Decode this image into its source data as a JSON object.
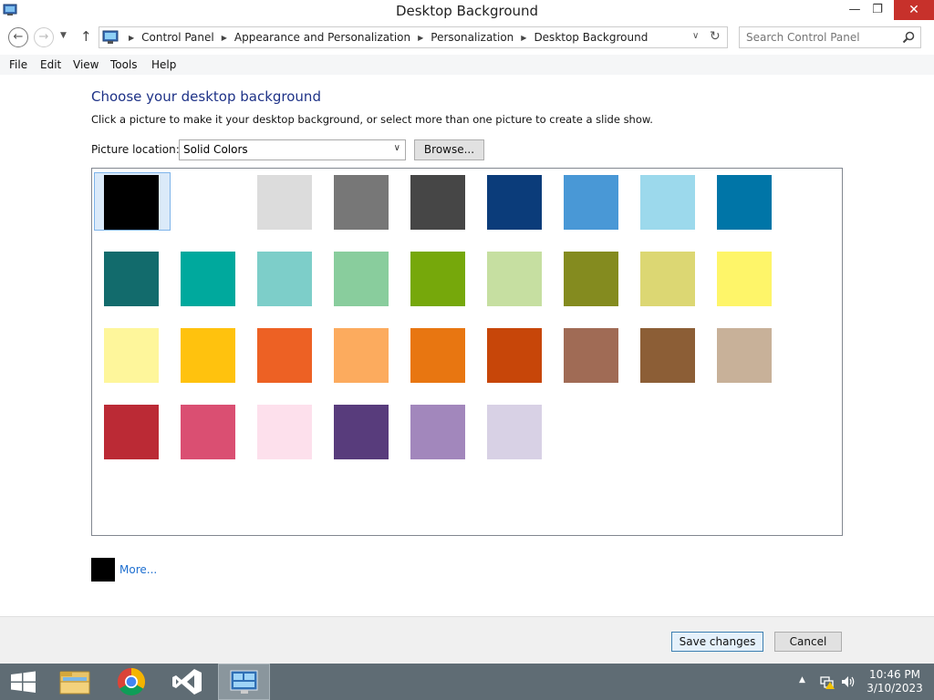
{
  "window": {
    "title": "Desktop Background",
    "minimize_glyph": "—",
    "maximize_glyph": "❐",
    "close_glyph": "✕"
  },
  "nav": {
    "breadcrumbs": [
      "Control Panel",
      "Appearance and Personalization",
      "Personalization",
      "Desktop Background"
    ],
    "search_placeholder": "Search Control Panel"
  },
  "menu": [
    "File",
    "Edit",
    "View",
    "Tools",
    "Help"
  ],
  "main": {
    "heading": "Choose your desktop background",
    "instruction": "Click a picture to make it your desktop background, or select more than one picture to create a slide show.",
    "location_label": "Picture location:",
    "location_value": "Solid Colors",
    "browse_label": "Browse...",
    "more_label": "More...",
    "current_color": "#000000",
    "selected_index": 0,
    "colors": [
      "#000000",
      "#ffffff",
      "#dcdcdc",
      "#777777",
      "#464646",
      "#0b3c7a",
      "#4998d6",
      "#9cd9ec",
      "#0075a7",
      "#126b6c",
      "#00a99d",
      "#7dcec9",
      "#89cd9d",
      "#76a80b",
      "#c6dfa1",
      "#848b1f",
      "#dcd773",
      "#fef569",
      "#fef69b",
      "#ffc20e",
      "#ed6124",
      "#fcab5e",
      "#e87611",
      "#c74609",
      "#a06b55",
      "#8c5e36",
      "#c8b199",
      "#bb2a35",
      "#da4f72",
      "#fde0ec",
      "#583c7c",
      "#a287bc",
      "#d8d1e5"
    ]
  },
  "buttons": {
    "save": "Save changes",
    "cancel": "Cancel"
  },
  "taskbar": {
    "time": "10:46 PM",
    "date": "3/10/2023",
    "tray_up_glyph": "▲"
  }
}
